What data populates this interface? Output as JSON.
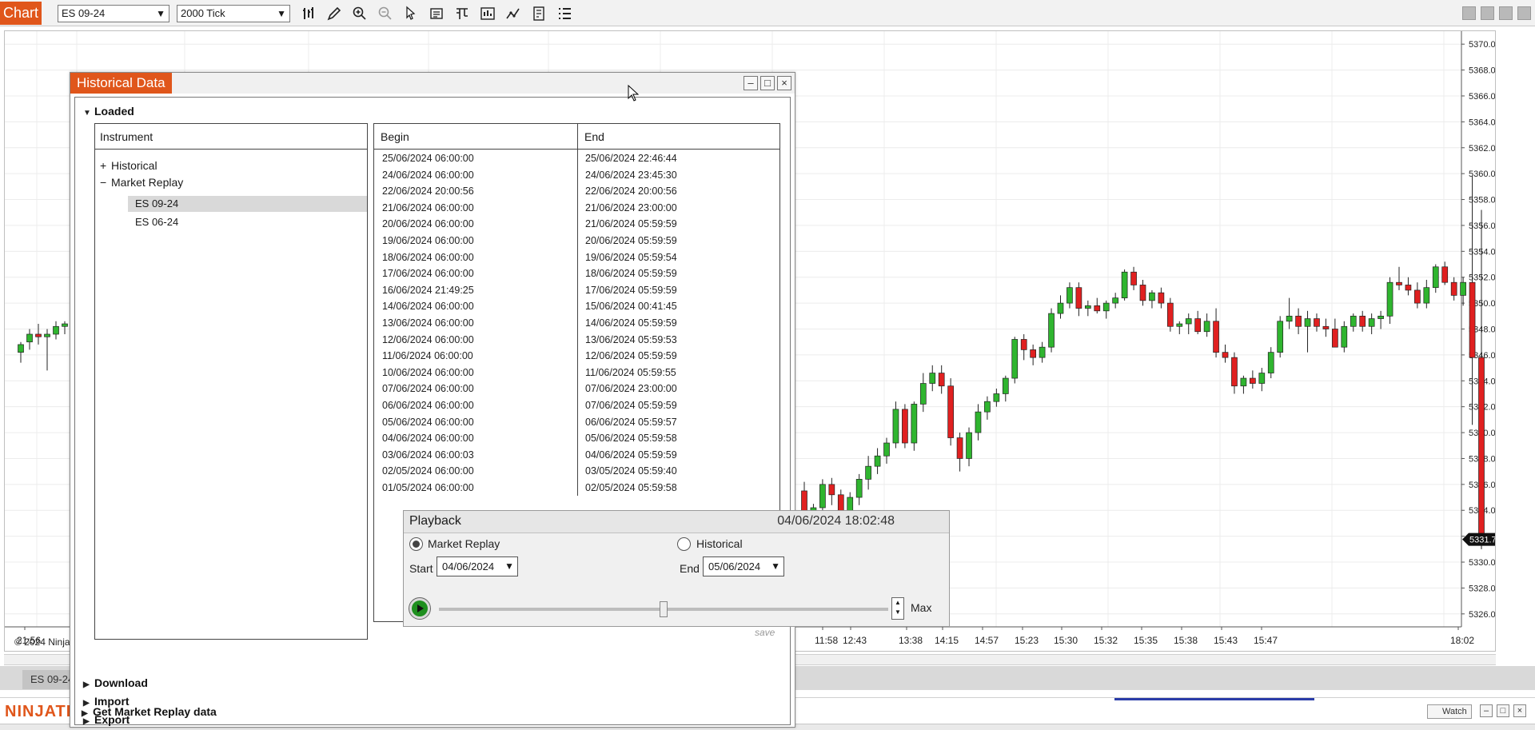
{
  "toolbar": {
    "chart_tab": "Chart",
    "instrument": "ES 09-24",
    "interval": "2000 Tick",
    "icons": [
      "bar-style-icon",
      "drawing-tools-icon",
      "zoom-in-icon",
      "zoom-out-icon",
      "pointer-icon",
      "data-box-icon",
      "properties-icon",
      "chart-trader-icon",
      "indicators-icon",
      "strategies-icon",
      "list-icon"
    ]
  },
  "chart": {
    "price_labels": [
      "5370.00",
      "5368.00",
      "5366.00",
      "5364.00",
      "5362.00",
      "5360.00",
      "5358.00",
      "5356.00",
      "5354.00",
      "5352.00",
      "5350.00",
      "5348.00",
      "5346.00",
      "5344.00",
      "5342.00",
      "5340.00",
      "5338.00",
      "5336.00",
      "5334.00",
      "5332.00",
      "5330.00",
      "5328.00",
      "5326.00"
    ],
    "current_price": "5331.75",
    "time_labels": [
      "21:56",
      "11:58",
      "12:43",
      "13:38",
      "14:15",
      "14:57",
      "15:23",
      "15:30",
      "15:32",
      "15:35",
      "15:38",
      "15:43",
      "15:47",
      "18:02"
    ],
    "copyright": "© 2024 NinjaTrader",
    "bottom_tab": "ES 09-24",
    "colors": {
      "up": "#2fb52f",
      "down": "#e02020",
      "accent": "#e0561b"
    }
  },
  "chart_data": {
    "type": "candlestick",
    "y_range": [
      5325,
      5371
    ],
    "candles": [
      [
        5346.2,
        5347.0,
        5345.4,
        5346.8
      ],
      [
        5347.0,
        5348.0,
        5346.4,
        5347.6
      ],
      [
        5347.6,
        5348.4,
        5346.8,
        5347.4
      ],
      [
        5347.4,
        5348.0,
        5344.8,
        5347.6
      ],
      [
        5347.6,
        5348.6,
        5347.2,
        5348.2
      ],
      [
        5348.2,
        5348.6,
        5347.6,
        5348.4
      ],
      [
        5335.5,
        5336.2,
        5333.0,
        5333.4
      ],
      [
        5333.0,
        5334.5,
        5332.0,
        5334.2
      ],
      [
        5334.2,
        5336.4,
        5333.6,
        5336.0
      ],
      [
        5336.0,
        5336.5,
        5334.4,
        5335.2
      ],
      [
        5335.2,
        5335.6,
        5333.2,
        5333.8
      ],
      [
        5333.6,
        5335.4,
        5333.0,
        5335.0
      ],
      [
        5335.0,
        5336.8,
        5334.4,
        5336.4
      ],
      [
        5336.4,
        5338.2,
        5335.6,
        5337.4
      ],
      [
        5337.4,
        5338.8,
        5336.8,
        5338.2
      ],
      [
        5338.2,
        5339.6,
        5337.6,
        5339.2
      ],
      [
        5339.2,
        5342.4,
        5338.8,
        5341.8
      ],
      [
        5341.8,
        5342.2,
        5338.8,
        5339.2
      ],
      [
        5339.2,
        5342.4,
        5338.6,
        5342.2
      ],
      [
        5342.2,
        5344.6,
        5341.6,
        5343.8
      ],
      [
        5343.8,
        5345.2,
        5343.2,
        5344.6
      ],
      [
        5344.6,
        5345.2,
        5343.0,
        5343.6
      ],
      [
        5343.6,
        5344.2,
        5339.0,
        5339.6
      ],
      [
        5339.6,
        5340.0,
        5337.0,
        5338.0
      ],
      [
        5338.0,
        5340.4,
        5337.4,
        5340.0
      ],
      [
        5340.0,
        5342.2,
        5339.4,
        5341.6
      ],
      [
        5341.6,
        5342.8,
        5341.0,
        5342.4
      ],
      [
        5342.4,
        5343.4,
        5342.0,
        5343.0
      ],
      [
        5343.0,
        5344.4,
        5342.4,
        5344.2
      ],
      [
        5344.2,
        5347.4,
        5343.8,
        5347.2
      ],
      [
        5347.2,
        5347.6,
        5345.6,
        5346.4
      ],
      [
        5346.4,
        5346.8,
        5345.2,
        5345.8
      ],
      [
        5345.8,
        5347.0,
        5345.4,
        5346.6
      ],
      [
        5346.6,
        5349.6,
        5346.2,
        5349.2
      ],
      [
        5349.2,
        5350.6,
        5348.8,
        5350.0
      ],
      [
        5350.0,
        5351.6,
        5349.6,
        5351.2
      ],
      [
        5351.2,
        5351.6,
        5349.0,
        5349.6
      ],
      [
        5349.6,
        5350.2,
        5349.0,
        5349.8
      ],
      [
        5349.8,
        5350.4,
        5349.2,
        5349.4
      ],
      [
        5349.4,
        5350.2,
        5348.8,
        5350.0
      ],
      [
        5350.0,
        5350.8,
        5349.6,
        5350.4
      ],
      [
        5350.4,
        5352.6,
        5350.2,
        5352.4
      ],
      [
        5352.4,
        5352.8,
        5351.0,
        5351.4
      ],
      [
        5351.4,
        5351.8,
        5349.8,
        5350.2
      ],
      [
        5350.2,
        5351.0,
        5349.6,
        5350.8
      ],
      [
        5350.8,
        5351.2,
        5349.6,
        5350.0
      ],
      [
        5350.0,
        5350.4,
        5347.8,
        5348.2
      ],
      [
        5348.2,
        5348.6,
        5347.6,
        5348.4
      ],
      [
        5348.4,
        5349.2,
        5347.6,
        5348.8
      ],
      [
        5348.8,
        5349.4,
        5347.6,
        5347.8
      ],
      [
        5347.8,
        5349.2,
        5347.4,
        5348.6
      ],
      [
        5348.6,
        5349.6,
        5345.8,
        5346.2
      ],
      [
        5346.2,
        5346.8,
        5345.4,
        5345.8
      ],
      [
        5345.8,
        5346.2,
        5343.0,
        5343.6
      ],
      [
        5343.6,
        5344.4,
        5343.0,
        5344.2
      ],
      [
        5344.2,
        5344.8,
        5343.4,
        5343.8
      ],
      [
        5343.8,
        5345.0,
        5343.2,
        5344.6
      ],
      [
        5344.6,
        5346.6,
        5344.2,
        5346.2
      ],
      [
        5346.2,
        5349.0,
        5345.8,
        5348.6
      ],
      [
        5348.6,
        5350.4,
        5348.0,
        5349.0
      ],
      [
        5349.0,
        5349.6,
        5347.6,
        5348.2
      ],
      [
        5348.2,
        5349.4,
        5346.2,
        5348.8
      ],
      [
        5348.8,
        5349.2,
        5347.8,
        5348.2
      ],
      [
        5348.2,
        5348.8,
        5347.4,
        5348.0
      ],
      [
        5348.0,
        5348.8,
        5346.6,
        5346.6
      ],
      [
        5346.6,
        5348.6,
        5346.2,
        5348.2
      ],
      [
        5348.2,
        5349.2,
        5347.8,
        5349.0
      ],
      [
        5349.0,
        5349.4,
        5347.8,
        5348.2
      ],
      [
        5348.2,
        5349.2,
        5347.6,
        5348.8
      ],
      [
        5348.8,
        5349.4,
        5348.0,
        5349.0
      ],
      [
        5349.0,
        5352.0,
        5348.4,
        5351.6
      ],
      [
        5351.6,
        5352.8,
        5351.0,
        5351.4
      ],
      [
        5351.4,
        5352.0,
        5350.6,
        5351.0
      ],
      [
        5351.0,
        5351.6,
        5349.6,
        5350.0
      ],
      [
        5350.0,
        5351.8,
        5349.6,
        5351.2
      ],
      [
        5351.2,
        5353.0,
        5350.8,
        5352.8
      ],
      [
        5352.8,
        5353.2,
        5351.4,
        5351.6
      ],
      [
        5351.6,
        5352.0,
        5350.2,
        5350.6
      ],
      [
        5350.6,
        5352.0,
        5349.8,
        5351.6
      ],
      [
        5351.6,
        5359.8,
        5340.6,
        5345.8
      ],
      [
        5345.8,
        5357.2,
        5331.0,
        5331.8
      ]
    ]
  },
  "historical_data": {
    "title": "Historical Data",
    "sections": {
      "loaded": "Loaded",
      "download": "Download",
      "import": "Import",
      "export": "Export",
      "get_replay": "Get Market Replay data"
    },
    "instrument_header": "Instrument",
    "tree": [
      {
        "toggle": "+",
        "label": "Historical"
      },
      {
        "toggle": "−",
        "label": "Market Replay"
      },
      {
        "toggle": "",
        "label": "ES 09-24"
      },
      {
        "toggle": "",
        "label": "ES 06-24"
      }
    ],
    "begin_header": "Begin",
    "end_header": "End",
    "rows": [
      [
        "25/06/2024 06:00:00",
        "25/06/2024 22:46:44"
      ],
      [
        "24/06/2024 06:00:00",
        "24/06/2024 23:45:30"
      ],
      [
        "22/06/2024 20:00:56",
        "22/06/2024 20:00:56"
      ],
      [
        "21/06/2024 06:00:00",
        "21/06/2024 23:00:00"
      ],
      [
        "20/06/2024 06:00:00",
        "21/06/2024 05:59:59"
      ],
      [
        "19/06/2024 06:00:00",
        "20/06/2024 05:59:59"
      ],
      [
        "18/06/2024 06:00:00",
        "19/06/2024 05:59:54"
      ],
      [
        "17/06/2024 06:00:00",
        "18/06/2024 05:59:59"
      ],
      [
        "16/06/2024 21:49:25",
        "17/06/2024 05:59:59"
      ],
      [
        "14/06/2024 06:00:00",
        "15/06/2024 00:41:45"
      ],
      [
        "13/06/2024 06:00:00",
        "14/06/2024 05:59:59"
      ],
      [
        "12/06/2024 06:00:00",
        "13/06/2024 05:59:53"
      ],
      [
        "11/06/2024 06:00:00",
        "12/06/2024 05:59:59"
      ],
      [
        "10/06/2024 06:00:00",
        "11/06/2024 05:59:55"
      ],
      [
        "07/06/2024 06:00:00",
        "07/06/2024 23:00:00"
      ],
      [
        "06/06/2024 06:00:00",
        "07/06/2024 05:59:59"
      ],
      [
        "05/06/2024 06:00:00",
        "06/06/2024 05:59:57"
      ],
      [
        "04/06/2024 06:00:00",
        "05/06/2024 05:59:58"
      ],
      [
        "03/06/2024 06:00:03",
        "04/06/2024 05:59:59"
      ],
      [
        "02/05/2024 06:00:00",
        "03/05/2024 05:59:40"
      ],
      [
        "01/05/2024 06:00:00",
        "02/05/2024 05:59:58"
      ]
    ],
    "save_label": "save"
  },
  "playback": {
    "title": "Playback",
    "timestamp": "04/06/2024 18:02:48",
    "market_replay_label": "Market Replay",
    "historical_label": "Historical",
    "start_label": "Start",
    "start_value": "04/06/2024",
    "end_label": "End",
    "end_value": "05/06/2024",
    "speed_label": "Max",
    "position": 0.5
  },
  "statusbar": {
    "logo": "NINJATRADER",
    "watch_label": "Watch"
  }
}
